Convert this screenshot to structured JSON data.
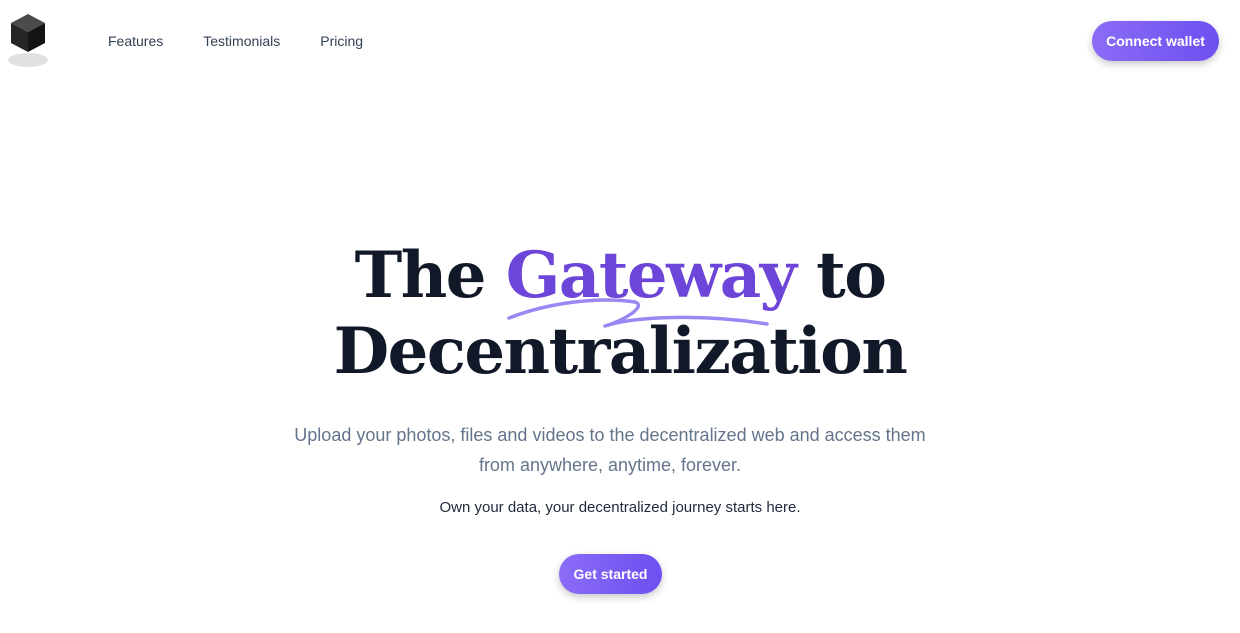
{
  "header": {
    "logo_icon": "cube-icon",
    "nav": [
      {
        "label": "Features"
      },
      {
        "label": "Testimonials"
      },
      {
        "label": "Pricing"
      }
    ],
    "connect_label": "Connect wallet"
  },
  "hero": {
    "headline_before": "The ",
    "headline_highlight": "Gateway",
    "headline_after": " to",
    "headline_line2": "Decentralization",
    "subtitle": "Upload your photos, files and videos to the decentralized web and access them from anywhere, anytime, forever.",
    "tagline": "Own your data, your decentralized journey starts here.",
    "cta_label": "Get started"
  },
  "colors": {
    "accent": "#6d45d8",
    "button_gradient_start": "#8b6cf7",
    "button_gradient_end": "#6e4ff0",
    "heading": "#111827",
    "muted": "#64748b"
  }
}
